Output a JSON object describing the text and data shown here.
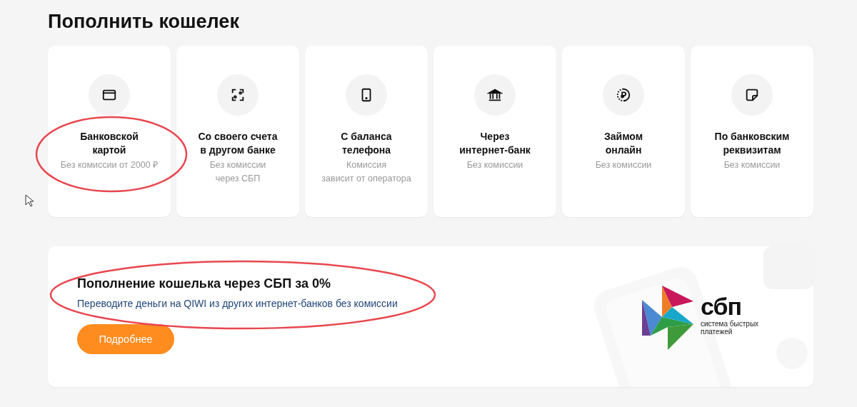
{
  "title": "Пополнить кошелек",
  "methods": [
    {
      "kind": "card",
      "title": "Банковской\nкартой",
      "note": "Без комиссии от 2000 ₽",
      "highlighted": true
    },
    {
      "kind": "transfer",
      "title": "Со своего счета\nв другом банке",
      "note": "Без комиссии\nчерез СБП",
      "highlighted": false
    },
    {
      "kind": "phone",
      "title": "С баланса\nтелефона",
      "note": "Комиссия\nзависит от оператора",
      "highlighted": false
    },
    {
      "kind": "bank",
      "title": "Через\nинтернет-банк",
      "note": "Без комиссии",
      "highlighted": false
    },
    {
      "kind": "loan",
      "title": "Займом\nонлайн",
      "note": "Без комиссии",
      "highlighted": false
    },
    {
      "kind": "details",
      "title": "По банковским\nреквизитам",
      "note": "Без комиссии",
      "highlighted": false
    }
  ],
  "banner": {
    "title": "Пополнение кошелька через СБП за 0%",
    "text": "Переводите деньги на QIWI из других интернет-банков без комиссии",
    "button": "Подробнее",
    "highlighted": true,
    "logo": {
      "name": "сбп",
      "tagline": "система быстрых\nплатежей"
    }
  }
}
